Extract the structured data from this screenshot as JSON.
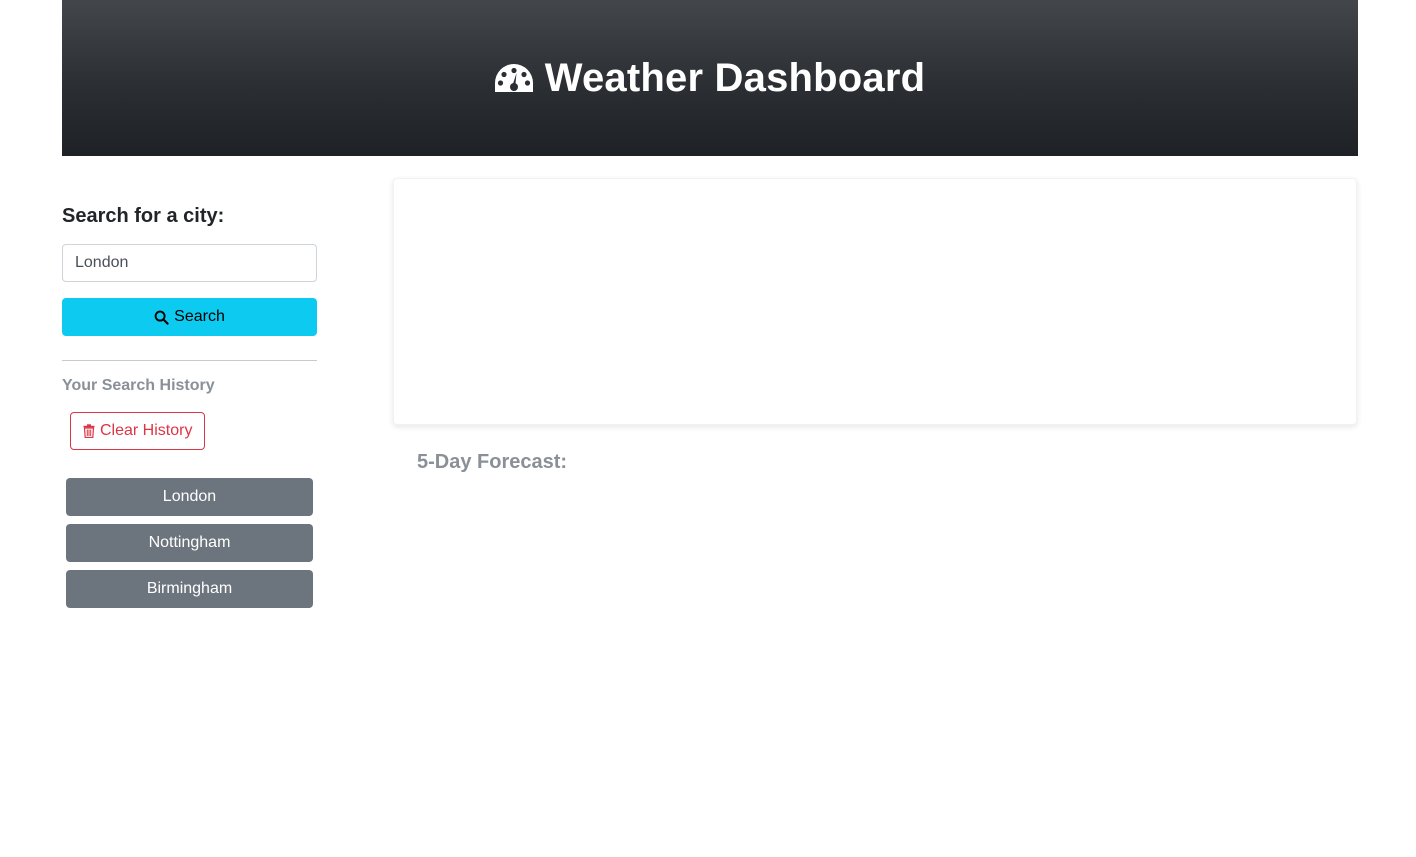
{
  "header": {
    "title": "Weather Dashboard",
    "icon": "dashboard-gauge-icon"
  },
  "sidebar": {
    "search_label": "Search for a city:",
    "input_value": "London",
    "search_button": {
      "label": "Search",
      "icon": "search-icon",
      "color": "#0dcaf0"
    },
    "history_title": "Your Search History",
    "clear_button": {
      "label": "Clear History",
      "icon": "trash-icon",
      "color": "#dc3545"
    },
    "history": [
      {
        "label": "London"
      },
      {
        "label": "Nottingham"
      },
      {
        "label": "Birmingham"
      }
    ]
  },
  "main": {
    "forecast_title": "5-Day Forecast:"
  },
  "colors": {
    "header_gradient_top": "#43474c",
    "header_gradient_bottom": "#1e2125",
    "history_button": "#6c757d",
    "muted_text": "#8a9097"
  }
}
